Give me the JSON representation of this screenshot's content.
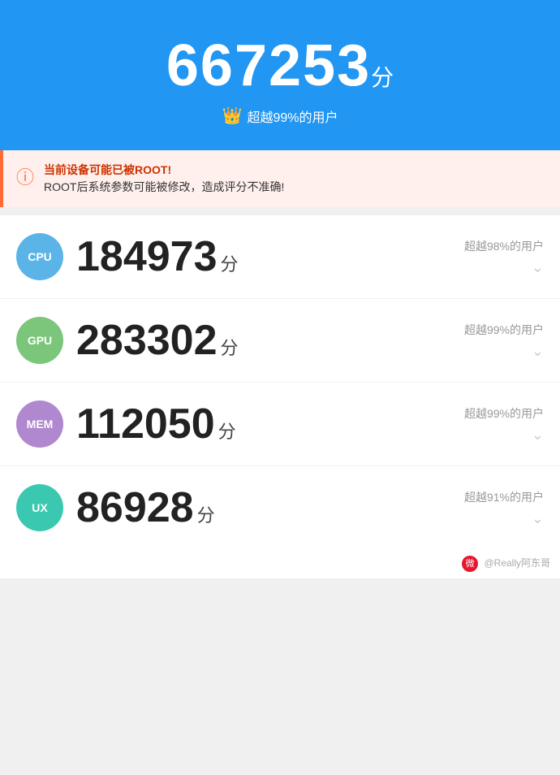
{
  "header": {
    "score": "667253",
    "score_unit": "分",
    "subtitle_icon": "👑",
    "subtitle_text": "超越99%的用户"
  },
  "warning": {
    "icon": "ⓘ",
    "title": "当前设备可能已被ROOT!",
    "body": "ROOT后系统参数可能被修改，造成评分不准确!"
  },
  "scores": [
    {
      "badge": "CPU",
      "badge_class": "badge-cpu",
      "score": "184973",
      "unit": "分",
      "percentile": "超越98%的用户"
    },
    {
      "badge": "GPU",
      "badge_class": "badge-gpu",
      "score": "283302",
      "unit": "分",
      "percentile": "超越99%的用户"
    },
    {
      "badge": "MEM",
      "badge_class": "badge-mem",
      "score": "112050",
      "unit": "分",
      "percentile": "超越99%的用户"
    },
    {
      "badge": "UX",
      "badge_class": "badge-ux",
      "score": "86928",
      "unit": "分",
      "percentile": "超越91%的用户"
    }
  ],
  "watermark": {
    "label": "@Really阿东哥"
  }
}
